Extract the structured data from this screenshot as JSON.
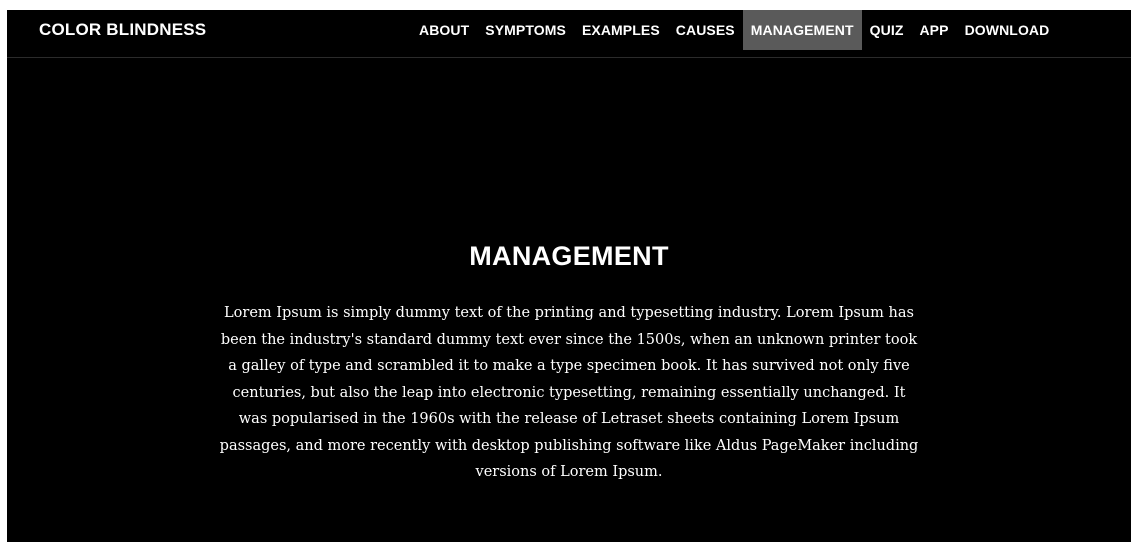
{
  "brand": "COLOR BLINDNESS",
  "nav": {
    "items": [
      {
        "label": "ABOUT"
      },
      {
        "label": "SYMPTOMS"
      },
      {
        "label": "EXAMPLES"
      },
      {
        "label": "CAUSES"
      },
      {
        "label": "MANAGEMENT",
        "active": true
      },
      {
        "label": "QUIZ"
      },
      {
        "label": "APP"
      },
      {
        "label": "DOWNLOAD"
      }
    ]
  },
  "hero": {
    "title": "MANAGEMENT",
    "body": "Lorem Ipsum is simply dummy text of the printing and typesetting industry. Lorem Ipsum has been the industry's standard dummy text ever since the 1500s, when an unknown printer took a galley of type and scrambled it to make a type specimen book. It has survived not only five centuries, but also the leap into electronic typesetting, remaining essentially unchanged. It was popularised in the 1960s with the release of Letraset sheets containing Lorem Ipsum passages, and more recently with desktop publishing software like Aldus PageMaker including versions of Lorem Ipsum."
  },
  "colors": {
    "background": "#000000",
    "text": "#ffffff",
    "active_nav_bg": "#5a5a5a"
  }
}
